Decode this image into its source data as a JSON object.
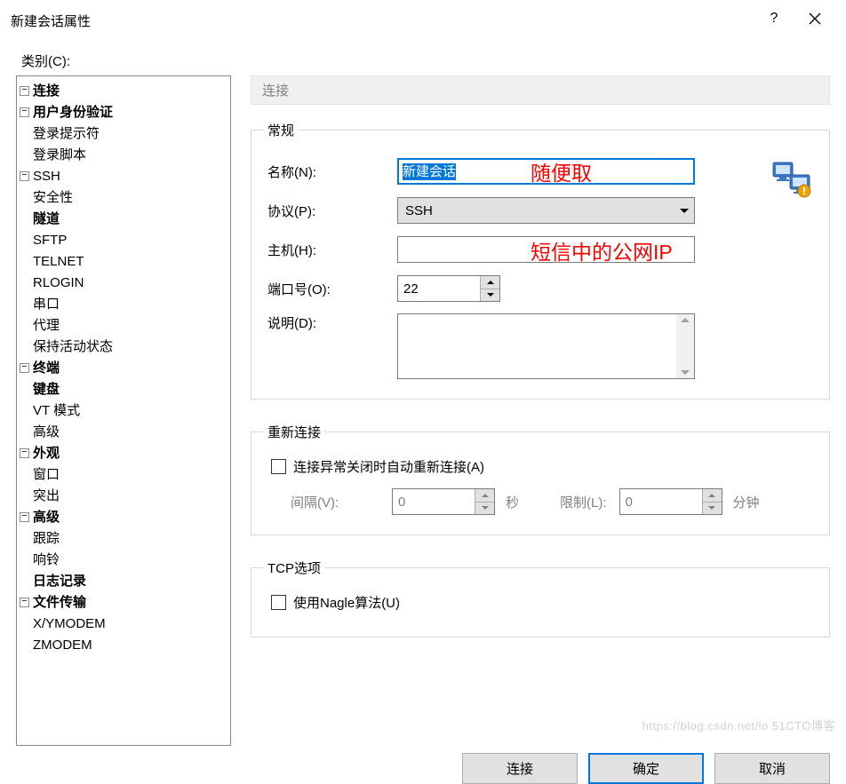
{
  "window": {
    "title": "新建会话属性",
    "help": "?",
    "close_aria": "关闭"
  },
  "category": {
    "label": "类别(C):"
  },
  "tree": {
    "connection": "连接",
    "auth": "用户身份验证",
    "login_prompt": "登录提示符",
    "login_script": "登录脚本",
    "ssh": "SSH",
    "security": "安全性",
    "tunnel": "隧道",
    "sftp": "SFTP",
    "telnet": "TELNET",
    "rlogin": "RLOGIN",
    "serial": "串口",
    "proxy": "代理",
    "keepalive": "保持活动状态",
    "terminal": "终端",
    "keyboard": "键盘",
    "vtmode": "VT 模式",
    "advanced_t": "高级",
    "appearance": "外观",
    "window": "窗口",
    "highlight": "突出",
    "advanced": "高级",
    "trace": "跟踪",
    "bell": "响铃",
    "logging": "日志记录",
    "file_transfer": "文件传输",
    "xymodem": "X/YMODEM",
    "zmodem": "ZMODEM"
  },
  "header": {
    "title": "连接"
  },
  "general": {
    "legend": "常规",
    "name_label": "名称(N):",
    "name_value": "新建会话",
    "name_annot": "随便取",
    "protocol_label": "协议(P):",
    "protocol_value": "SSH",
    "host_label": "主机(H):",
    "host_value": "",
    "host_annot": "短信中的公网IP",
    "port_label": "端口号(O):",
    "port_value": "22",
    "desc_label": "说明(D):"
  },
  "reconnect": {
    "legend": "重新连接",
    "checkbox_label": "连接异常关闭时自动重新连接(A)",
    "interval_label": "间隔(V):",
    "interval_value": "0",
    "interval_unit": "秒",
    "limit_label": "限制(L):",
    "limit_value": "0",
    "limit_unit": "分钟"
  },
  "tcp": {
    "legend": "TCP选项",
    "nagle_label": "使用Nagle算法(U)"
  },
  "buttons": {
    "connect": "连接",
    "ok": "确定",
    "cancel": "取消"
  },
  "watermark": "https://blog.csdn.net/lo  51CTO博客"
}
